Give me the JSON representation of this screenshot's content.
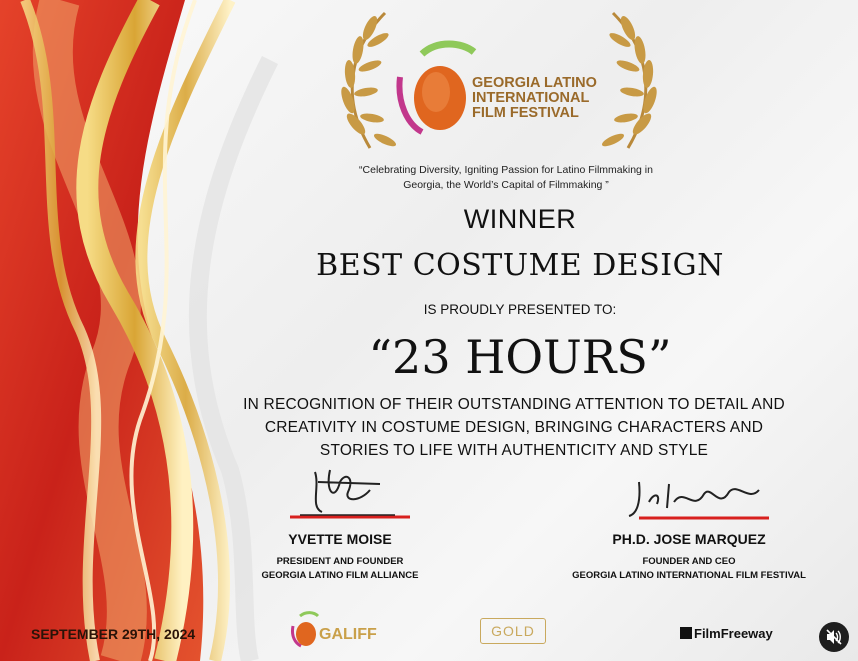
{
  "festival": {
    "name_lines": [
      "GEORGIA LATINO",
      "INTERNATIONAL",
      "FILM FESTIVAL"
    ],
    "tagline_lines": [
      "“Celebrating Diversity, Igniting Passion for Latino Filmmaking in",
      "Georgia, the World’s Capital of Filmmaking ”"
    ]
  },
  "certificate": {
    "status": "WINNER",
    "award": "BEST COSTUME DESIGN",
    "presented_to": "IS PROUDLY PRESENTED TO:",
    "film_title": "“23 HOURS”",
    "recognition_lines": [
      "IN RECOGNITION OF THEIR OUTSTANDING ATTENTION TO DETAIL AND",
      "CREATIVITY IN COSTUME DESIGN, BRINGING CHARACTERS AND",
      "STORIES TO LIFE WITH AUTHENTICITY AND STYLE"
    ]
  },
  "signatories": [
    {
      "name": "YVETTE MOISE",
      "role_lines": [
        "PRESIDENT AND FOUNDER",
        "GEORGIA LATINO FILM ALLIANCE"
      ]
    },
    {
      "name": "PH.D. JOSE MARQUEZ",
      "role_lines": [
        "FOUNDER AND CEO",
        "GEORGIA LATINO INTERNATIONAL FILM FESTIVAL"
      ]
    }
  ],
  "footer": {
    "date": "SEPTEMBER 29TH, 2024",
    "galiff_logo": "GALIFF",
    "gold_logo": "GOLD",
    "filmfreeway_logo": "FilmFreeway"
  },
  "controls": {
    "mute_icon": "speaker-muted-icon"
  },
  "colors": {
    "accent_gold": "#c9a04a",
    "signature_underline": "#d8201e",
    "logo_orange": "#e0661f"
  }
}
